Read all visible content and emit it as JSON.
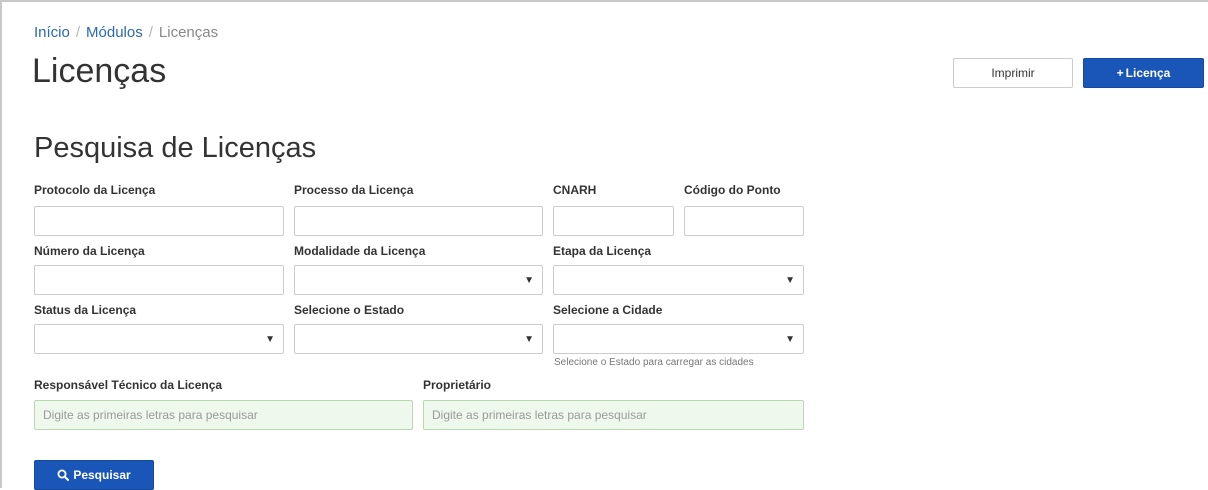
{
  "breadcrumb": {
    "home": "Início",
    "separator": "/",
    "modules": "Módulos",
    "current": "Licenças"
  },
  "header": {
    "title": "Licenças",
    "print_label": "Imprimir",
    "add_plus": "+",
    "add_label": "Licença"
  },
  "search": {
    "title": "Pesquisa de Licenças",
    "fields": {
      "protocolo": {
        "label": "Protocolo da Licença",
        "value": ""
      },
      "processo": {
        "label": "Processo da Licença",
        "value": ""
      },
      "cnarh": {
        "label": "CNARH",
        "value": ""
      },
      "codigo_ponto": {
        "label": "Código do Ponto",
        "value": ""
      },
      "numero": {
        "label": "Número da Licença",
        "value": ""
      },
      "modalidade": {
        "label": "Modalidade da Licença",
        "value": ""
      },
      "etapa": {
        "label": "Etapa da Licença",
        "value": ""
      },
      "status": {
        "label": "Status da Licença",
        "value": ""
      },
      "estado": {
        "label": "Selecione o Estado",
        "value": ""
      },
      "cidade": {
        "label": "Selecione a Cidade",
        "value": "",
        "help": "Selecione o Estado para carregar as cidades"
      },
      "responsavel": {
        "label": "Responsável Técnico da Licença",
        "placeholder": "Digite as primeiras letras para pesquisar"
      },
      "proprietario": {
        "label": "Proprietário",
        "placeholder": "Digite as primeiras letras para pesquisar"
      }
    },
    "submit_label": "Pesquisar"
  },
  "colors": {
    "primary": "#1a56b8",
    "link": "#2a69b4",
    "autocomplete_bg": "#eef8ec"
  }
}
